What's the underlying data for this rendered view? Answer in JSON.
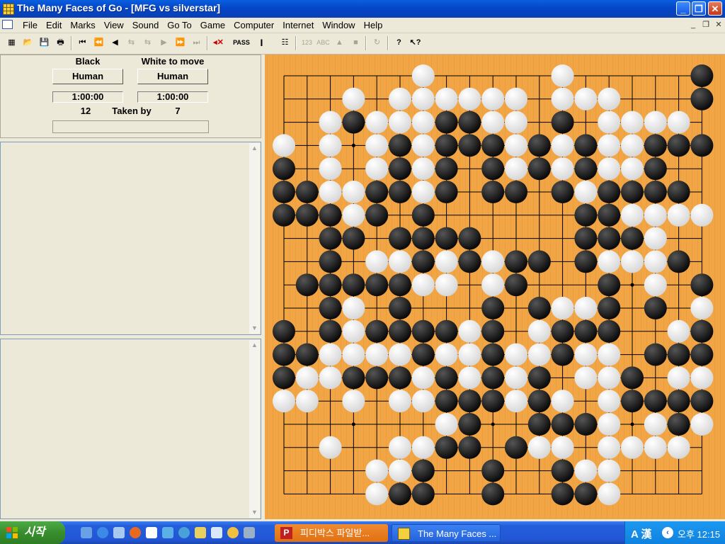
{
  "window": {
    "title": "The Many Faces of Go - [MFG vs silverstar]",
    "buttons": [
      "minimize-icon",
      "restore-icon",
      "close-icon"
    ]
  },
  "menu": [
    "File",
    "Edit",
    "Marks",
    "View",
    "Sound",
    "Go To",
    "Game",
    "Computer",
    "Internet",
    "Window",
    "Help"
  ],
  "toolbar": {
    "pass_label": "PASS",
    "num_label": "123",
    "abc_label": "ABC"
  },
  "panel": {
    "black_label": "Black",
    "white_label": "White to move",
    "black_player": "Human",
    "white_player": "Human",
    "black_time": "1:00:00",
    "white_time": "1:00:00",
    "black_captures": "12",
    "taken_by_label": "Taken by",
    "white_captures": "7"
  },
  "board": {
    "size": 19,
    "colors": {
      "wood": "#f0a040",
      "line": "#000000",
      "black": "#111111",
      "white": "#ffffff"
    },
    "rows": [
      "......W.....W.....B..B",
      "...W.WWWWWW.WWW...BW",
      "..WBWWWBBWW.B.WWWW",
      "W.W.WBWBBBWBWBWWBBBB",
      "B W WBWB.BWBWBWWB",
      "BBWWBBWB.BB.BWBBBB",
      "BBBWB.B......BBWWWW",
      "..BB.BBBB....BBBW",
      "..B.WWBWBWBB.BWWWB",
      ".BBBBBWW.WB...B.W.B",
      "..BW.B...B.BWWB.B.WB",
      "B.BWBBBBWB.WBBB..WB",
      "BBWWWWBWWBWWBWW.BBB",
      "BWWBBBWBWBWB.WWB.WW",
      "WW.W.WWBBBWBW.WBBBB",
      ".......WB..BBBW.WBWW",
      "..W..WWBB.BWW.WWWW",
      "....WWB..B..BWW",
      "....WBB..B..BBW"
    ]
  },
  "taskbar": {
    "start_label": "시작",
    "tasks": [
      {
        "label": "피디박스 파일받...",
        "icon": "p-app-icon"
      },
      {
        "label": "The Many Faces ...",
        "icon": "go-board-icon"
      }
    ],
    "tray": {
      "ime": "A 漢",
      "clock": "오후 12:15"
    }
  }
}
